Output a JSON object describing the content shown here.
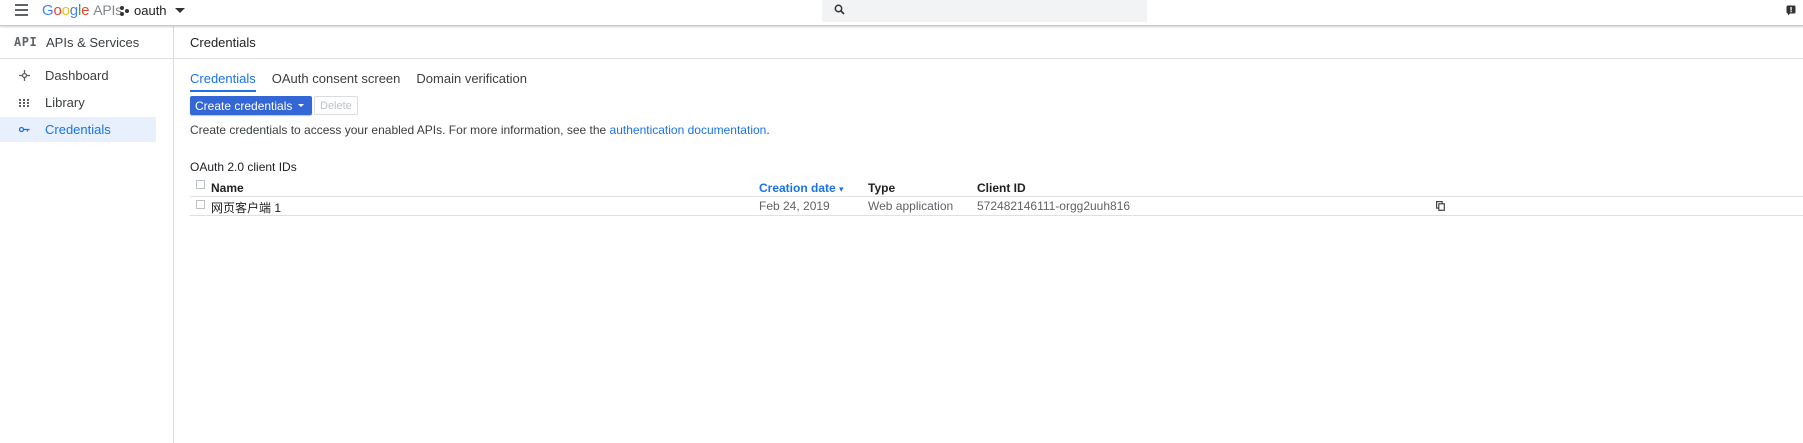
{
  "topbar": {
    "logo_google": [
      "G",
      "o",
      "o",
      "g",
      "l",
      "e"
    ],
    "logo_suffix": "APIs",
    "project_name": "oauth",
    "menu_icon": "hamburger-icon",
    "search_icon": "search-icon",
    "notifications_icon": "notifications-icon"
  },
  "sidebar": {
    "header_icon": "API",
    "header_title": "APIs & Services",
    "items": [
      {
        "label": "Dashboard",
        "icon": "dashboard-icon"
      },
      {
        "label": "Library",
        "icon": "library-icon"
      },
      {
        "label": "Credentials",
        "icon": "key-icon",
        "active": true
      }
    ]
  },
  "main": {
    "page_title": "Credentials",
    "tabs": [
      {
        "label": "Credentials",
        "active": true
      },
      {
        "label": "OAuth consent screen"
      },
      {
        "label": "Domain verification"
      }
    ],
    "create_button": "Create credentials",
    "delete_button": "Delete",
    "info_text": "Create credentials to access your enabled APIs. For more information, see the ",
    "info_link": "authentication documentation",
    "info_end": ".",
    "section_title": "OAuth 2.0 client IDs",
    "table": {
      "headers": [
        "Name",
        "Creation date",
        "Type",
        "Client ID"
      ],
      "sort_indicator": "▾",
      "rows": [
        {
          "name": "网页客户端 1",
          "date": "Feb 24, 2019",
          "type": "Web application",
          "client_id": "572482146111-orgg2uuh816"
        }
      ]
    }
  },
  "colors": {
    "accent": "#1a73e8",
    "button": "#3367d6",
    "active_bg": "#e8f0fe"
  }
}
